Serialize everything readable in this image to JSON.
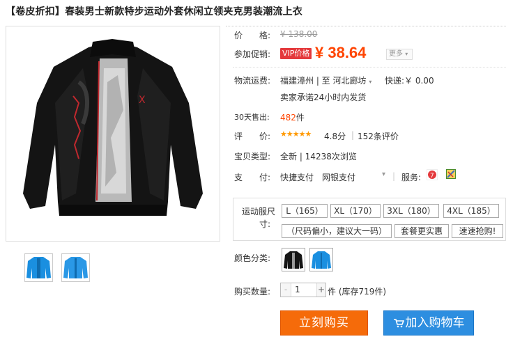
{
  "title": "【卷皮折扣】春装男士新款特步运动外套休闲立领夹克男装潮流上衣",
  "price": {
    "label": "价　　格:",
    "original": "¥ 138.00"
  },
  "promo": {
    "label": "参加促销:",
    "badge": "VIP价格",
    "current": "¥ 38.64",
    "more": "更多"
  },
  "shipping": {
    "label": "物流运费:",
    "route": "福建漳州 | 至 河北廊坊",
    "express": "快递:￥ 0.00",
    "note": "卖家承诺24小时内发货"
  },
  "sales": {
    "label": "30天售出:",
    "count": "482",
    "unit": "件"
  },
  "rating": {
    "label": "评　　价:",
    "stars": 5,
    "score": "4.8分",
    "reviews": "152条评价"
  },
  "item_type": {
    "label": "宝贝类型:",
    "value": "全新 | 14238次浏览"
  },
  "payment": {
    "label": "支　　付:",
    "methods": "快捷支付　网银支付",
    "service_label": "服务:"
  },
  "size": {
    "label1": "运动服尺",
    "label2": "寸:",
    "options": [
      "L（165）",
      "XL（170）",
      "3XL（180）",
      "4XL（185）",
      "（尺码偏小，建议大一码）",
      "套餐更实惠",
      "速速抢购!"
    ]
  },
  "color": {
    "label": "颜色分类:"
  },
  "quantity": {
    "label": "购买数量:",
    "value": "1",
    "stock": "件 (库存719件)"
  },
  "actions": {
    "buy_now": "立刻购买",
    "add_cart": "加入购物车"
  }
}
